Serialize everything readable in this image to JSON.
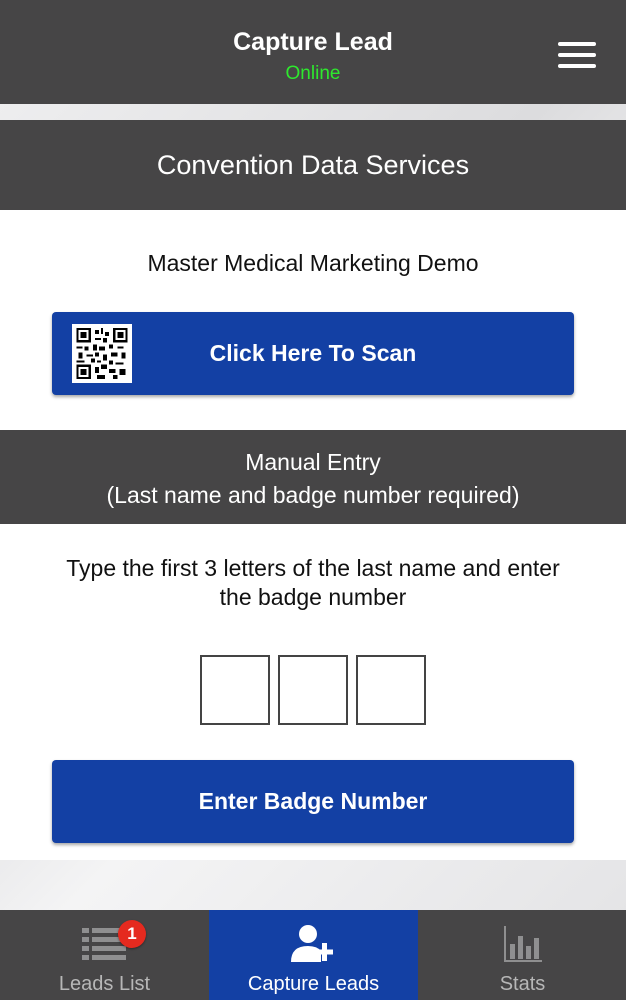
{
  "header": {
    "title": "Capture Lead",
    "status": "Online"
  },
  "org_name": "Convention Data Services",
  "event_name": "Master Medical Marketing Demo",
  "scan_button_label": "Click Here To Scan",
  "manual_entry": {
    "title": "Manual Entry",
    "subtitle": "(Last name and badge number required)",
    "instructions": "Type the first 3 letters of the last name and enter the badge number",
    "letters": [
      "",
      "",
      ""
    ],
    "submit_label": "Enter Badge Number"
  },
  "tabs": [
    {
      "label": "Leads List",
      "icon": "list-icon",
      "badge": "1"
    },
    {
      "label": "Capture Leads",
      "icon": "add-user-icon"
    },
    {
      "label": "Stats",
      "icon": "bar-chart-icon"
    }
  ],
  "colors": {
    "primary": "#1340a4",
    "header": "#464546",
    "online": "#2ee82e",
    "badge": "#e52a1f"
  }
}
